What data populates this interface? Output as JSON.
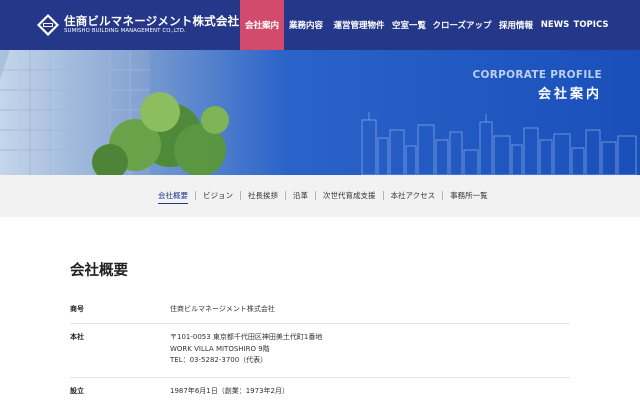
{
  "header": {
    "logo_jp": "住商ビルマネージメント株式会社",
    "logo_en": "SUMISHO BUILDING MANAGEMENT CO.,LTD.",
    "nav": [
      {
        "label": "会社案内",
        "active": true
      },
      {
        "label": "業務内容",
        "active": false
      },
      {
        "label": "運営管理物件",
        "active": false
      },
      {
        "label": "空室一覧",
        "active": false
      },
      {
        "label": "クローズアップ",
        "active": false
      },
      {
        "label": "採用情報",
        "active": false
      },
      {
        "label": "NEWS",
        "active": false
      },
      {
        "label": "TOPICS",
        "active": false
      }
    ]
  },
  "hero": {
    "title_en": "CORPORATE PROFILE",
    "title_jp": "会社案内"
  },
  "subnav": [
    {
      "label": "会社概要",
      "active": true
    },
    {
      "label": "ビジョン",
      "active": false
    },
    {
      "label": "社長挨拶",
      "active": false
    },
    {
      "label": "沿革",
      "active": false
    },
    {
      "label": "次世代育成支援",
      "active": false
    },
    {
      "label": "本社アクセス",
      "active": false
    },
    {
      "label": "事務所一覧",
      "active": false
    }
  ],
  "main": {
    "section_title": "会社概要",
    "rows": [
      {
        "label": "商号",
        "lines": [
          "住商ビルマネージメント株式会社"
        ]
      },
      {
        "label": "本社",
        "lines": [
          "〒101-0053 東京都千代田区神田美土代町1番地",
          "WORK VILLA MITOSHIRO 9階",
          "TEL：03-5282-3700（代表）"
        ]
      },
      {
        "label": "設立",
        "lines": [
          "1987年6月1日（創業：1973年2月）"
        ]
      }
    ]
  },
  "colors": {
    "header_bg": "#253788",
    "active_nav": "#d24a6c",
    "subnav_bg": "#f2f2f2"
  }
}
